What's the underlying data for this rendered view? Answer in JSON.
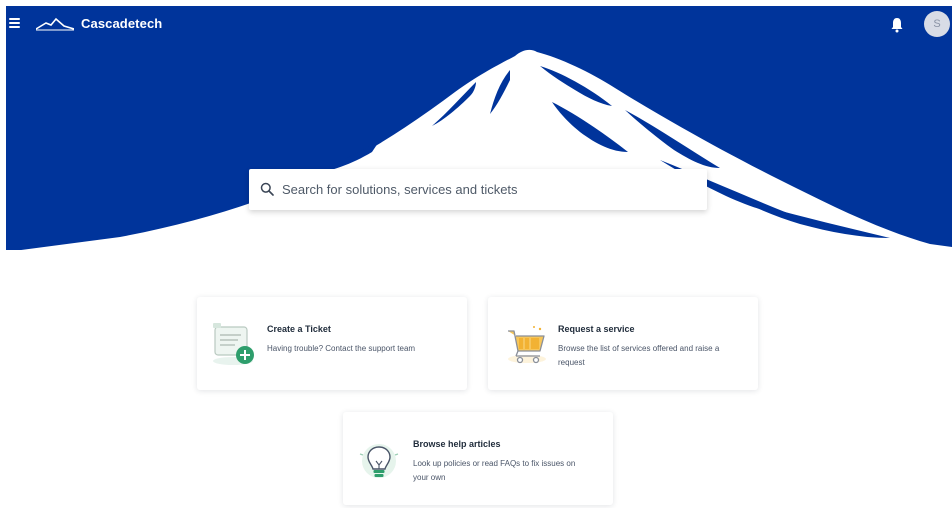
{
  "app": {
    "name": "Cascadetech"
  },
  "header": {
    "menu_icon": "hamburger-menu-icon",
    "logo_icon": "mountain-logo-icon",
    "notification_icon": "bell-icon",
    "avatar_initial": "S"
  },
  "hero": {
    "background_color": "#00349b",
    "mountain_color": "#ffffff"
  },
  "search": {
    "placeholder": "Search for solutions, services and tickets",
    "value": "",
    "icon": "search-icon"
  },
  "cards": [
    {
      "title": "Create a Ticket",
      "description": "Having trouble? Contact the support team",
      "icon": "ticket-add-icon"
    },
    {
      "title": "Request a service",
      "description": "Browse the list of services offered and raise a request",
      "icon": "shopping-cart-icon"
    },
    {
      "title": "Browse help articles",
      "description": "Look up policies or read FAQs to fix issues on your own",
      "icon": "lightbulb-icon"
    }
  ],
  "colors": {
    "brand_blue": "#00349b",
    "accent_green": "#2e9e6c",
    "accent_yellow": "#f2b233"
  }
}
